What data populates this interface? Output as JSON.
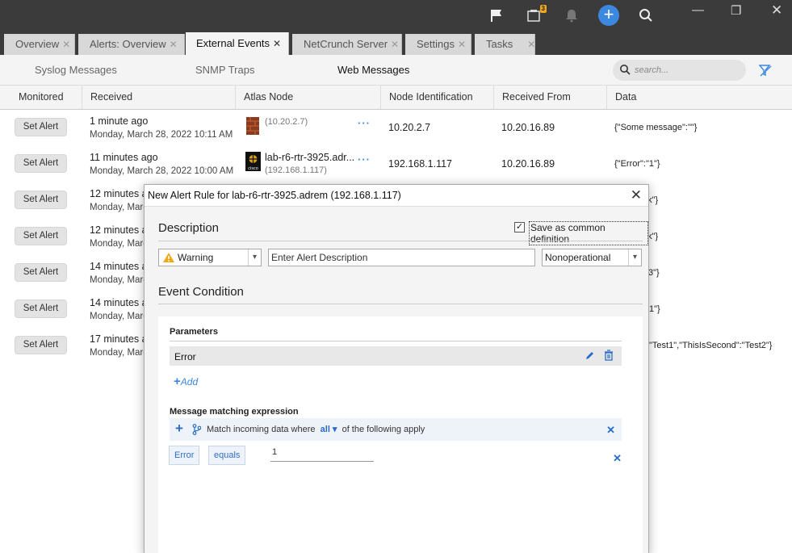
{
  "titlebar": {
    "notification_count": "3"
  },
  "tabs": [
    {
      "label": "Overview",
      "active": false
    },
    {
      "label": "Alerts: Overview",
      "active": false
    },
    {
      "label": "External Events",
      "active": true
    },
    {
      "label": "NetCrunch Server",
      "active": false
    },
    {
      "label": "Settings",
      "active": false
    },
    {
      "label": "Tasks",
      "active": false
    }
  ],
  "subnav": {
    "items": [
      "Syslog Messages",
      "SNMP Traps",
      "Web Messages"
    ],
    "active": "Web Messages",
    "search_placeholder": "search..."
  },
  "columns": [
    "Monitored",
    "Received",
    "Atlas Node",
    "Node Identification",
    "Received From",
    "Data"
  ],
  "rows": [
    {
      "button": "Set Alert",
      "ago": "1 minute ago",
      "date": "Monday, March 28, 2022 10:11 AM",
      "node_name": "",
      "node_ip": "(10.20.2.7)",
      "node_id": "10.20.2.7",
      "from": "10.20.16.89",
      "data": "{\"Some message\":\"\"}"
    },
    {
      "button": "Set Alert",
      "ago": "11 minutes ago",
      "date": "Monday, March 28, 2022 10:00 AM",
      "node_name": "lab-r6-rtr-3925.adr...",
      "node_ip": "(192.168.1.117)",
      "node_id": "192.168.1.117",
      "from": "10.20.16.89",
      "data": "{\"Error\":\"1\"}"
    },
    {
      "button": "Set Alert",
      "ago": "12 minutes a",
      "date": "Monday, Marc",
      "data": "ok\"}"
    },
    {
      "button": "Set Alert",
      "ago": "12 minutes a",
      "date": "Monday, Marc",
      "data": "ok\"}"
    },
    {
      "button": "Set Alert",
      "ago": "14 minutes a",
      "date": "Monday, Marc",
      "data": "3\"}"
    },
    {
      "button": "Set Alert",
      "ago": "14 minutes a",
      "date": "Monday, Marc",
      "data": "1\"}"
    },
    {
      "button": "Set Alert",
      "ago": "17 minutes a",
      "date": "Monday, Marc",
      "data": "\"Test1\",\"ThisIsSecond\":\"Test2\"}"
    }
  ],
  "dialog": {
    "title": "New Alert Rule for lab-r6-rtr-3925.adrem (192.168.1.117)",
    "description_heading": "Description",
    "save_common_label": "Save as common definition",
    "save_common_checked": true,
    "severity": "Warning",
    "description_placeholder": "Enter Alert Description",
    "state": "Nonoperational",
    "event_condition_heading": "Event Condition",
    "parameters_label": "Parameters",
    "parameter": "Error",
    "add_label": "Add",
    "matching_label": "Message matching expression",
    "match_prefix": "Match incoming data where",
    "match_quantifier": "all",
    "match_suffix": "of the following apply",
    "condition": {
      "field": "Error",
      "operator": "equals",
      "value": "1"
    }
  },
  "colors": {
    "accent": "#3c87e0",
    "titlebar": "#3b3b3b",
    "warning": "#f0a818"
  }
}
